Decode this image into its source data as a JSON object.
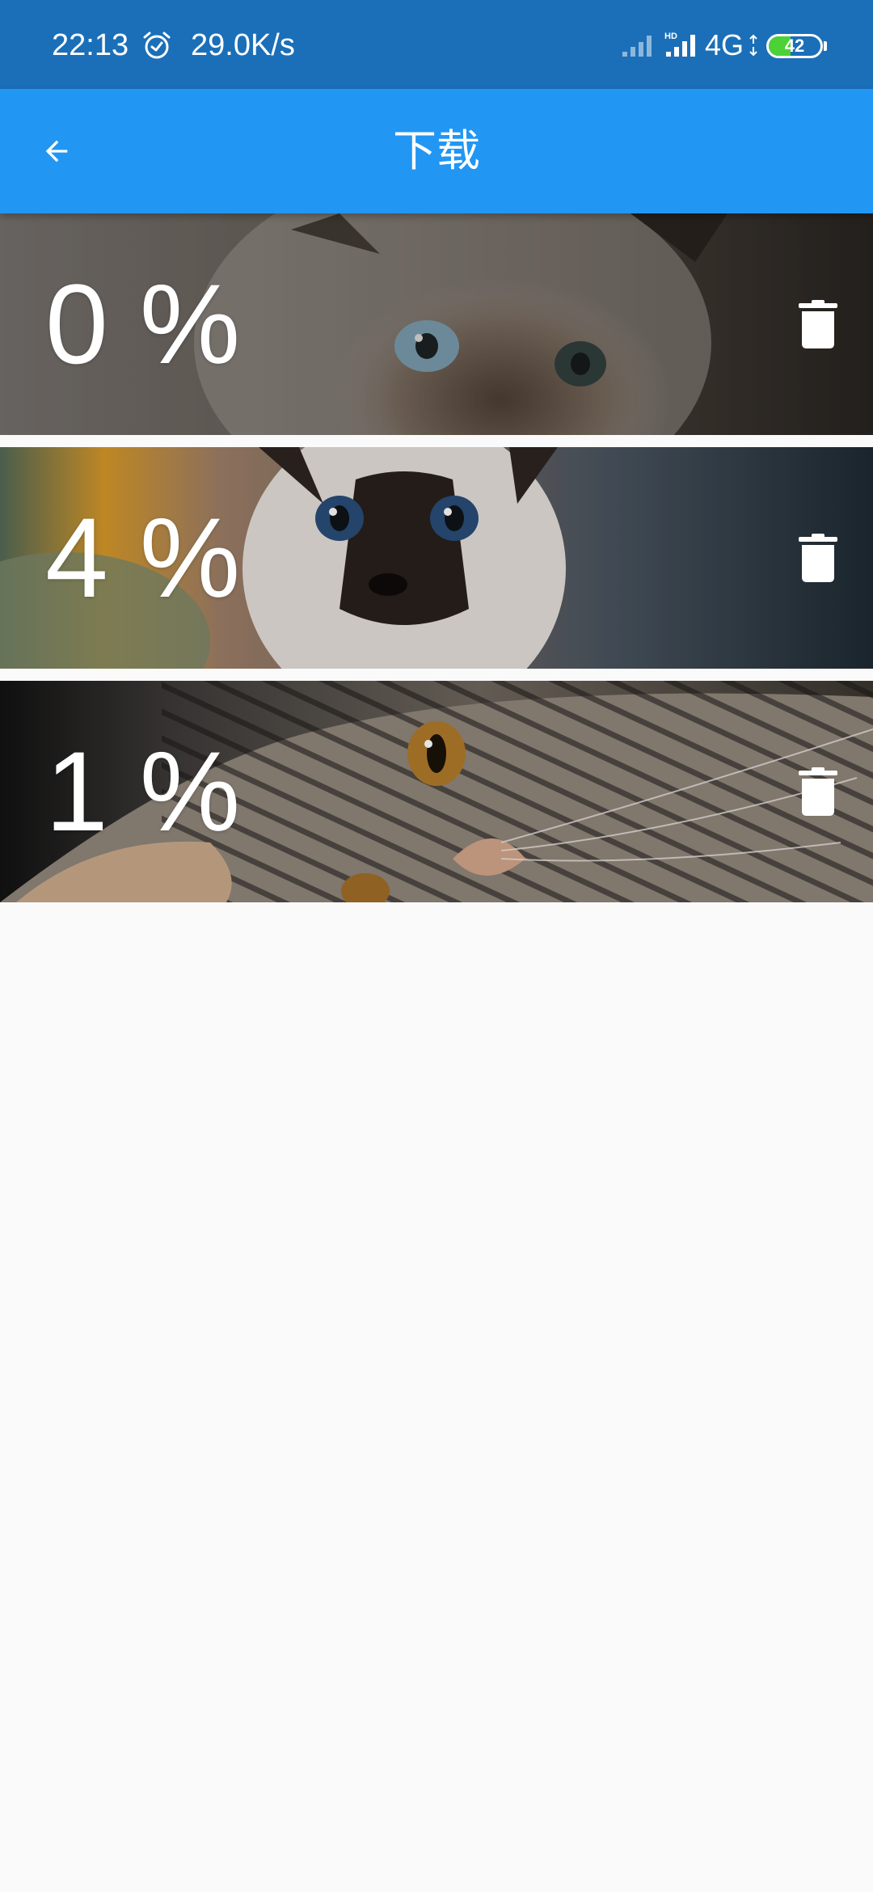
{
  "status_bar": {
    "time": "22:13",
    "net_speed": "29.0K/s",
    "network_type": "4G",
    "hd_label": "HD",
    "battery_level": "42",
    "battery_fraction": 0.42,
    "icons": [
      "alarm-icon",
      "signal-icon",
      "hd-signal-icon",
      "battery-icon"
    ]
  },
  "app_bar": {
    "title": "下载",
    "back_icon": "arrow-back-icon",
    "background_color": "#2196f3"
  },
  "downloads": [
    {
      "progress_label": "0 %",
      "progress_value": 0,
      "image": "siamese kitten with blue eyes, close-up",
      "delete_icon": "trash-icon"
    },
    {
      "progress_label": "4 %",
      "progress_value": 4,
      "image": "siamese kitten sitting, blue eyes",
      "delete_icon": "trash-icon"
    },
    {
      "progress_label": "1 %",
      "progress_value": 1,
      "image": "tabby kitten lying down with whiskers",
      "delete_icon": "trash-icon"
    }
  ],
  "colors": {
    "status_bar": "#1b6fb8",
    "app_bar": "#2196f3",
    "page_background": "#fafafa",
    "battery_fill": "#4cd137"
  }
}
